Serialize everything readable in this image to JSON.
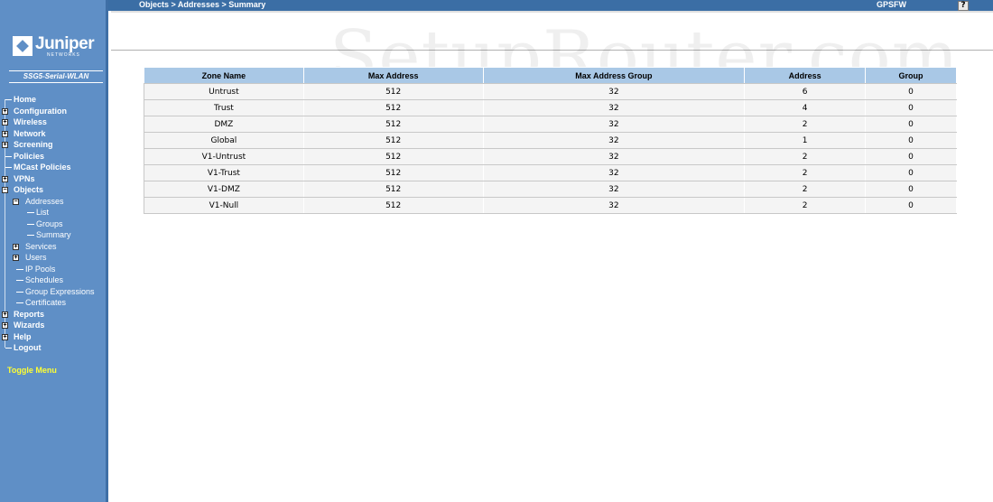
{
  "topbar": {
    "breadcrumb": "Objects > Addresses > Summary",
    "hostname": "GPSFW",
    "help_label": "?"
  },
  "sidebar": {
    "logo_text": "Juniper",
    "logo_sub": "NETWORKS",
    "device_name": "SSG5-Serial-WLAN",
    "items": [
      {
        "label": "Home",
        "level": 0,
        "expandable": false
      },
      {
        "label": "Configuration",
        "level": 0,
        "expandable": true
      },
      {
        "label": "Wireless",
        "level": 0,
        "expandable": true
      },
      {
        "label": "Network",
        "level": 0,
        "expandable": true
      },
      {
        "label": "Screening",
        "level": 0,
        "expandable": true
      },
      {
        "label": "Policies",
        "level": 0,
        "expandable": false
      },
      {
        "label": "MCast Policies",
        "level": 0,
        "expandable": false
      },
      {
        "label": "VPNs",
        "level": 0,
        "expandable": true
      },
      {
        "label": "Objects",
        "level": 0,
        "expandable": true,
        "expanded": true
      },
      {
        "label": "Addresses",
        "level": 1,
        "expandable": true,
        "expanded": true
      },
      {
        "label": "List",
        "level": 2,
        "expandable": false
      },
      {
        "label": "Groups",
        "level": 2,
        "expandable": false
      },
      {
        "label": "Summary",
        "level": 2,
        "expandable": false
      },
      {
        "label": "Services",
        "level": 1,
        "expandable": true
      },
      {
        "label": "Users",
        "level": 1,
        "expandable": true
      },
      {
        "label": "IP Pools",
        "level": 1,
        "expandable": false
      },
      {
        "label": "Schedules",
        "level": 1,
        "expandable": false
      },
      {
        "label": "Group Expressions",
        "level": 1,
        "expandable": false
      },
      {
        "label": "Certificates",
        "level": 1,
        "expandable": false
      },
      {
        "label": "Reports",
        "level": 0,
        "expandable": true
      },
      {
        "label": "Wizards",
        "level": 0,
        "expandable": true
      },
      {
        "label": "Help",
        "level": 0,
        "expandable": true
      },
      {
        "label": "Logout",
        "level": 0,
        "expandable": false
      }
    ],
    "toggle_menu": "Toggle Menu"
  },
  "watermark": "SetupRouter.com",
  "table": {
    "headers": [
      "Zone Name",
      "Max Address",
      "Max Address Group",
      "Address",
      "Group"
    ],
    "rows": [
      [
        "Untrust",
        "512",
        "32",
        "6",
        "0"
      ],
      [
        "Trust",
        "512",
        "32",
        "4",
        "0"
      ],
      [
        "DMZ",
        "512",
        "32",
        "2",
        "0"
      ],
      [
        "Global",
        "512",
        "32",
        "1",
        "0"
      ],
      [
        "V1-Untrust",
        "512",
        "32",
        "2",
        "0"
      ],
      [
        "V1-Trust",
        "512",
        "32",
        "2",
        "0"
      ],
      [
        "V1-DMZ",
        "512",
        "32",
        "2",
        "0"
      ],
      [
        "V1-Null",
        "512",
        "32",
        "2",
        "0"
      ]
    ]
  }
}
